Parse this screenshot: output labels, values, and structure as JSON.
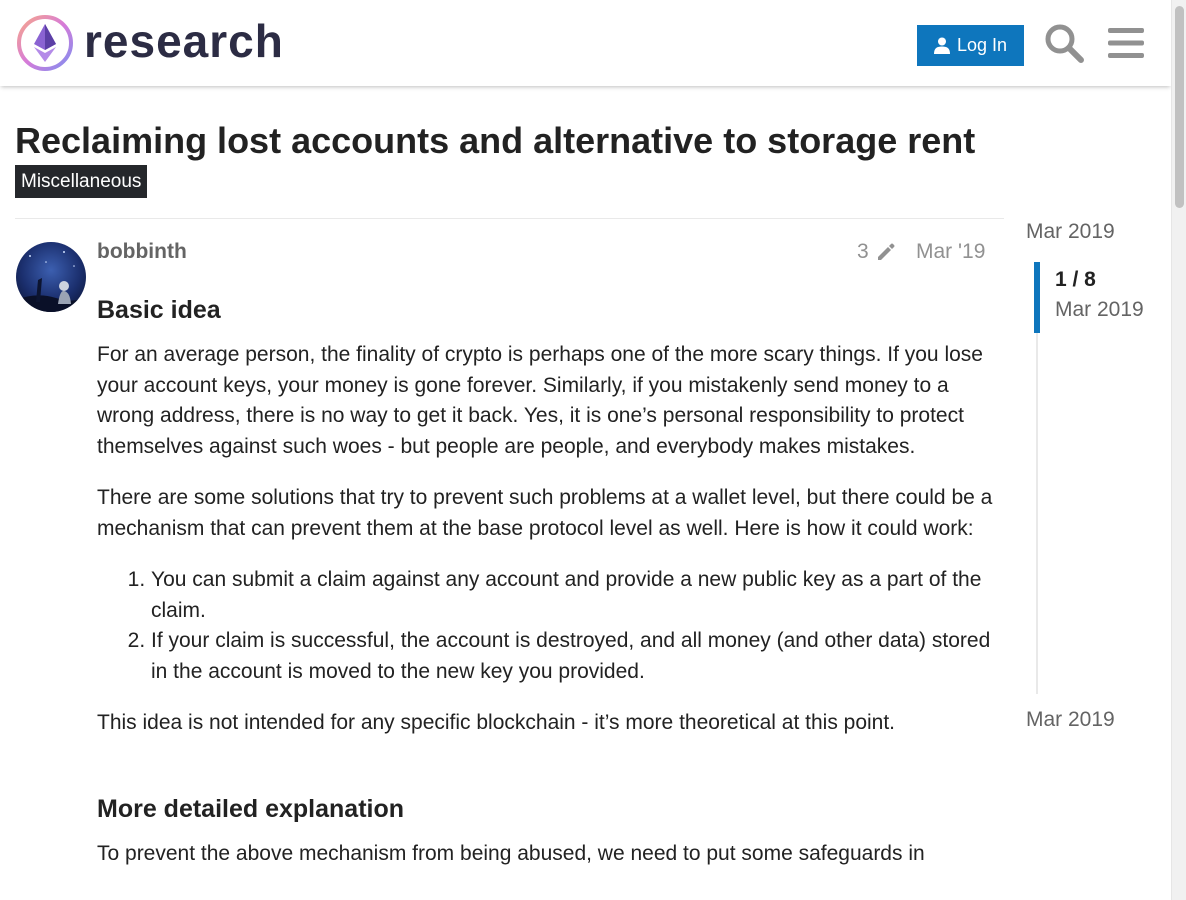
{
  "header": {
    "logo_text": "research",
    "login_label": "Log In"
  },
  "topic": {
    "title": "Reclaiming lost accounts and alternative to storage rent",
    "category": "Miscellaneous"
  },
  "post": {
    "username": "bobbinth",
    "edit_count": "3",
    "date": "Mar '19",
    "heading1": "Basic idea",
    "para1": "For an average person, the finality of crypto is perhaps one of the more scary things. If you lose your account keys, your money is gone forever. Similarly, if you mistakenly send money to a wrong address, there is no way to get it back. Yes, it is one’s personal responsibility to protect themselves against such woes - but people are people, and everybody makes mistakes.",
    "para2": "There are some solutions that try to prevent such problems at a wallet level, but there could be a mechanism that can prevent them at the base protocol level as well. Here is how it could work:",
    "list": [
      "You can submit a claim against any account and provide a new public key as a part of the claim.",
      "If your claim is successful, the account is destroyed, and all money (and other data) stored in the account is moved to the new key you provided."
    ],
    "para3": "This idea is not intended for any specific blockchain - it’s more theoretical at this point.",
    "heading2": "More detailed explanation",
    "para4": "To prevent the above mechanism from being abused, we need to put some safeguards in"
  },
  "timeline": {
    "start": "Mar 2019",
    "position": "1 / 8",
    "position_date": "Mar 2019",
    "end": "Mar 2019"
  },
  "colors": {
    "accent": "#0e76bd",
    "category_bg": "#25272b",
    "muted_text": "#919191"
  }
}
